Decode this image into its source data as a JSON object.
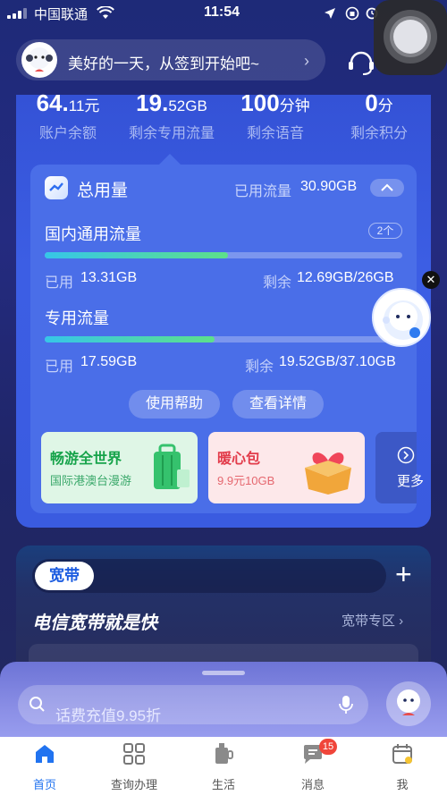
{
  "status_bar": {
    "carrier": "中国联通",
    "time": "11:54"
  },
  "header": {
    "greeting": "美好的一天，从签到开始吧~"
  },
  "stats": [
    {
      "value": "64.",
      "unit": "11元",
      "label": "账户余额"
    },
    {
      "value": "19.",
      "unit": "52GB",
      "label": "剩余专用流量"
    },
    {
      "value": "100",
      "unit": "分钟",
      "label": "剩余语音"
    },
    {
      "value": "0",
      "unit": "分",
      "label": "剩余积分"
    }
  ],
  "usage": {
    "title": "总用量",
    "used_label": "已用流量",
    "used_value": "30.90GB",
    "domestic": {
      "title": "国内通用流量",
      "count_badge": "2个",
      "progress": 0.512,
      "used_label": "已用",
      "used_value": "13.31GB",
      "remain_label": "剩余",
      "remain_value": "12.69GB/26GB"
    },
    "dedicated": {
      "title": "专用流量",
      "progress": 0.474,
      "used_label": "已用",
      "used_value": "17.59GB",
      "remain_label": "剩余",
      "remain_value": "19.52GB/37.10GB"
    },
    "help_button": "使用帮助",
    "detail_button": "查看详情"
  },
  "promos": [
    {
      "title": "畅游全世界",
      "subtitle": "国际港澳台漫游"
    },
    {
      "title": "暖心包",
      "subtitle": "9.9元10GB"
    },
    {
      "title": "更多"
    }
  ],
  "broadband": {
    "tab": "宽带",
    "slogan": "电信宽带就是快",
    "zone_link": "宽带专区"
  },
  "search": {
    "placeholder": "话费充值9.95折"
  },
  "tabs": [
    {
      "label": "首页",
      "icon": "home-icon"
    },
    {
      "label": "查询办理",
      "icon": "grid-icon"
    },
    {
      "label": "生活",
      "icon": "life-icon"
    },
    {
      "label": "消息",
      "icon": "message-icon",
      "badge": "15"
    },
    {
      "label": "我",
      "icon": "calendar-icon"
    }
  ],
  "colors": {
    "accent": "#2173f0",
    "card": "#3a5be0",
    "badge": "#f0453a"
  }
}
